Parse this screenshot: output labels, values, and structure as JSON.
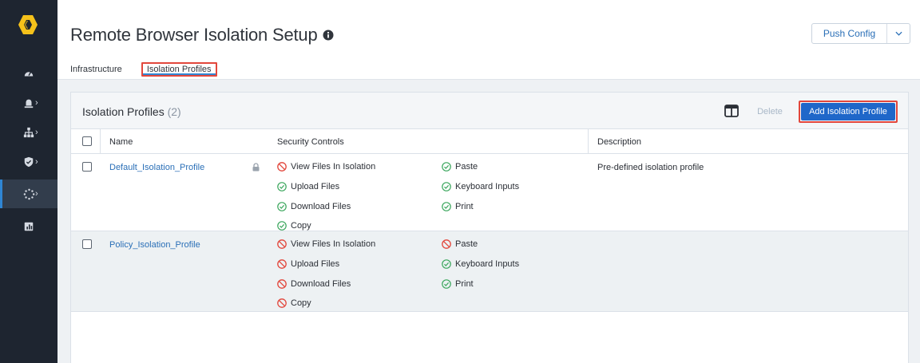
{
  "page": {
    "title": "Remote Browser Isolation Setup",
    "push_config_label": "Push Config"
  },
  "sidebar": {
    "items": [
      {
        "icon": "dashboard-gauge-icon"
      },
      {
        "icon": "alerts-icon"
      },
      {
        "icon": "network-topology-icon"
      },
      {
        "icon": "shield-icon"
      },
      {
        "icon": "isolation-icon",
        "active": true
      },
      {
        "icon": "reports-icon"
      }
    ]
  },
  "tabs": [
    {
      "label": "Infrastructure"
    },
    {
      "label": "Isolation Profiles",
      "active": true
    }
  ],
  "panel": {
    "title": "Isolation Profiles",
    "count": "(2)",
    "delete_label": "Delete",
    "add_label": "Add Isolation Profile"
  },
  "table": {
    "columns": [
      "Name",
      "Security Controls",
      "Description"
    ],
    "rows": [
      {
        "name": "Default_Isolation_Profile",
        "locked": true,
        "description": "Pre-defined isolation profile",
        "controls_left": [
          {
            "label": "View Files In Isolation",
            "status": "blocked"
          },
          {
            "label": "Upload Files",
            "status": "allowed"
          },
          {
            "label": "Download Files",
            "status": "allowed"
          },
          {
            "label": "Copy",
            "status": "allowed"
          }
        ],
        "controls_right": [
          {
            "label": "Paste",
            "status": "allowed"
          },
          {
            "label": "Keyboard Inputs",
            "status": "allowed"
          },
          {
            "label": "Print",
            "status": "allowed"
          }
        ]
      },
      {
        "name": "Policy_Isolation_Profile",
        "locked": false,
        "description": "",
        "controls_left": [
          {
            "label": "View Files In Isolation",
            "status": "blocked"
          },
          {
            "label": "Upload Files",
            "status": "blocked"
          },
          {
            "label": "Download Files",
            "status": "blocked"
          },
          {
            "label": "Copy",
            "status": "blocked"
          }
        ],
        "controls_right": [
          {
            "label": "Paste",
            "status": "blocked"
          },
          {
            "label": "Keyboard Inputs",
            "status": "allowed"
          },
          {
            "label": "Print",
            "status": "allowed"
          }
        ]
      }
    ]
  },
  "colors": {
    "sidebar_bg": "#1e2530",
    "accent_blue": "#1f67c9",
    "link_blue": "#2a6fb7",
    "allowed_green": "#3aa65c",
    "blocked_red": "#e2473c",
    "logo_yellow": "#f5c11a"
  }
}
